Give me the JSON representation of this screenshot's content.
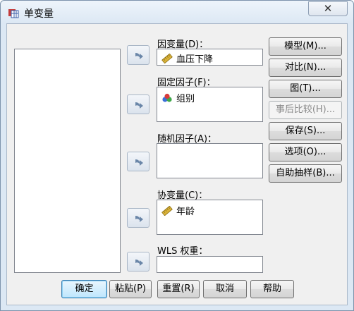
{
  "window": {
    "title": "单变量",
    "close_symbol": "✕",
    "icon": "spss-dialog-icon"
  },
  "arrow_symbol": "➜",
  "fields": {
    "dependent": {
      "label": "因变量(D)：",
      "value": "血压下降",
      "icon": "ruler-icon"
    },
    "fixed_factors": {
      "label": "固定因子(F)：",
      "value": "组别",
      "icon": "nominal-balls-icon"
    },
    "random_factors": {
      "label": "随机因子(A)："
    },
    "covariates": {
      "label": "协变量(C)：",
      "value": "年龄",
      "icon": "ruler-icon"
    },
    "wls_weight": {
      "label": "WLS 权重："
    }
  },
  "side_buttons": {
    "model": "模型(M)...",
    "contrast": "对比(N)...",
    "plots": "图(T)...",
    "post_hoc": "事后比较(H)...",
    "save": "保存(S)...",
    "options": "选项(O)...",
    "bootstrap": "自助抽样(B)..."
  },
  "bottom_buttons": {
    "ok": "确定",
    "paste": "粘贴(P)",
    "reset": "重置(R)",
    "cancel": "取消",
    "help": "帮助"
  },
  "colors": {
    "ruler": "#d9b23a",
    "ball_red": "#d83b3b",
    "ball_green": "#3fa84a",
    "ball_blue": "#3b6fd8"
  }
}
